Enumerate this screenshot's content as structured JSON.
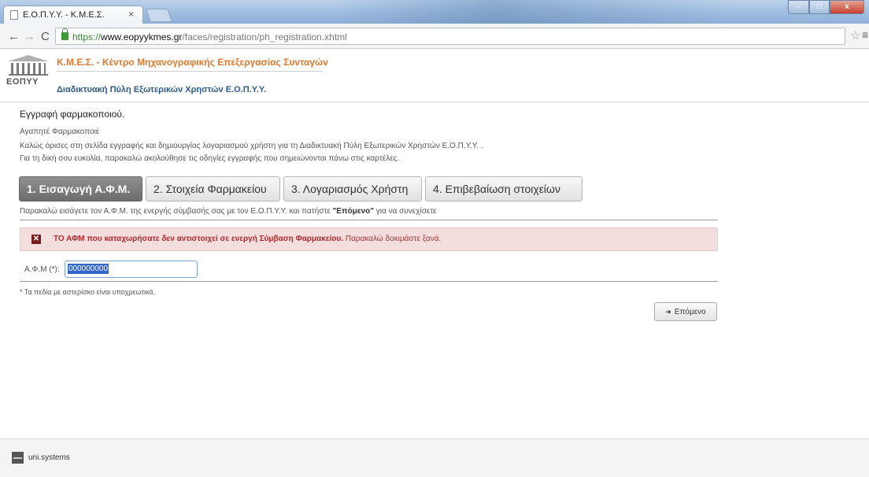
{
  "browser": {
    "tab_title": "Ε.Ο.Π.Υ.Υ. - Κ.Μ.Ε.Σ.",
    "tab_close": "×",
    "url_scheme": "https://",
    "url_host": "www.eopyykmes.gr",
    "url_path": "/faces/registration/ph_registration.xhtml",
    "nav_back": "←",
    "nav_forward": "→",
    "nav_reload": "C",
    "star_icon": "☆",
    "menu_icon": "≡"
  },
  "header": {
    "logo_text": "ΕΟΠΥΥ",
    "kmes_title": "Κ.Μ.Ε.Σ. - Κέντρο Μηχανογραφικής Επεξεργασίας Συνταγών",
    "portal_title": "Διαδικτυακή Πύλη Εξωτερικών Χρηστών Ε.Ο.Π.Υ.Υ."
  },
  "main": {
    "page_title": "Εγγραφή φαρμακοποιού.",
    "greeting": "Αγαπητέ Φαρμακοποιέ",
    "intro_line1": "Καλώς όρισες στη σελίδα εγγραφής και δημιουργίας λογαριασμού χρήστη για τη Διαδικτυακή Πύλη Εξωτερικών Χρηστών Ε.Ο.Π.Υ.Υ. .",
    "intro_line2": "Για τη δική σου ευκολία, παρακαλώ ακολούθησε τις οδηγίες εγγραφής που σημειώνονται πάνω στις καρτέλες.",
    "steps": [
      {
        "label": "1. Εισαγωγή Α.Φ.Μ."
      },
      {
        "label": "2. Στοιχεία Φαρμακείου"
      },
      {
        "label": "3. Λογαριασμός Χρήστη"
      },
      {
        "label": "4. Επιβεβαίωση στοιχείων"
      }
    ],
    "active_step": 1,
    "instruction_pre": "Παρακαλώ εισάγετε τον Α.Φ.Μ. της ενεργής σύμβασής σας με τον Ε.Ο.Π.Υ.Υ. και πατήστε ",
    "instruction_bold": "\"Επόμενο\"",
    "instruction_post": " για να συνεχίσετε",
    "error_icon": "✕",
    "error_bold": "ΤΟ ΑΦΜ που καταχωρήσατε δεν αντιστοιχεί σε ενεργή Σύμβαση Φαρμακείου.",
    "error_tail": " Παρακαλώ δοκιμάστε ξανά.",
    "afm_label": "Α.Φ.Μ (*):",
    "afm_value": "000000000",
    "required_note": "* Τα πεδία με αστερίσκο είναι υποχρεωτικά.",
    "next_label": "Επόμενο",
    "next_arrow": "➜"
  },
  "footer": {
    "company": "uni.systems"
  },
  "colors": {
    "brand_orange": "#e0782a",
    "portal_blue": "#2c5a8c",
    "error_bg": "#f3dddd",
    "active_tab": "#7d7d7d"
  }
}
